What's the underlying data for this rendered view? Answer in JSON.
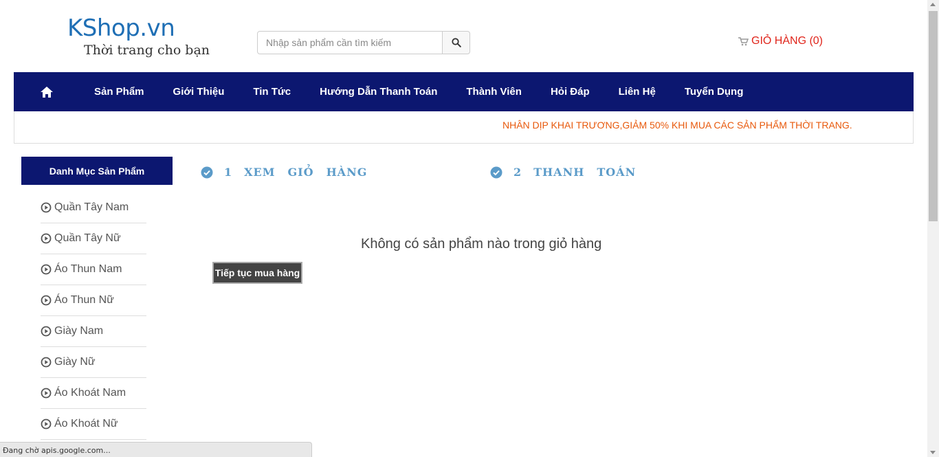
{
  "header": {
    "logo_text": "KShop.vn",
    "logo_tagline": "Thời trang cho bạn",
    "search_placeholder": "Nhập sản phẩm cần tìm kiếm",
    "cart_label": "GIỎ HÀNG (0)"
  },
  "nav": {
    "items": [
      {
        "label": "Sản Phẩm"
      },
      {
        "label": "Giới Thiệu"
      },
      {
        "label": "Tin Tức"
      },
      {
        "label": "Hướng Dẫn Thanh Toán"
      },
      {
        "label": "Thành Viên"
      },
      {
        "label": "Hỏi Đáp"
      },
      {
        "label": "Liên Hệ"
      },
      {
        "label": "Tuyển Dụng"
      }
    ]
  },
  "promo": {
    "text": "NHÂN DỊP KHAI TRƯƠNG,GIẢM 50% KHI MUA CÁC SẢN PHẨM THỜI TRANG."
  },
  "sidebar": {
    "title": "Danh Mục Sản Phẩm",
    "categories": [
      {
        "label": "Quần Tây Nam"
      },
      {
        "label": "Quần Tây Nữ"
      },
      {
        "label": "Áo Thun Nam"
      },
      {
        "label": "Áo Thun Nữ"
      },
      {
        "label": "Giày Nam"
      },
      {
        "label": "Giày Nữ"
      },
      {
        "label": "Áo Khoát Nam"
      },
      {
        "label": "Áo Khoát Nữ"
      }
    ]
  },
  "steps": [
    {
      "number": "1",
      "words": [
        "XEM",
        "GIỎ",
        "HÀNG"
      ]
    },
    {
      "number": "2",
      "words": [
        "THANH",
        "TOÁN"
      ]
    }
  ],
  "cart": {
    "empty_message": "Không có sản phẩm nào trong giỏ hàng",
    "continue_label": "Tiếp tục mua hàng"
  },
  "status_bar": {
    "text": "Đang chờ apis.google.com..."
  },
  "colors": {
    "nav_bg": "#0c1770",
    "cart_red": "#e0251b",
    "promo_orange": "#e8590c",
    "step_blue": "#5b9bc9"
  }
}
